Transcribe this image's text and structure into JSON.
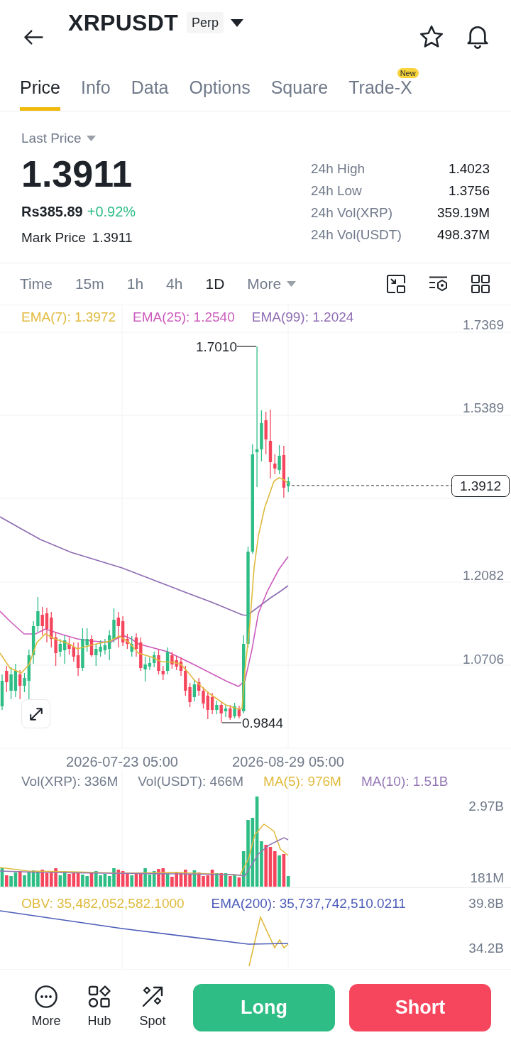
{
  "header": {
    "symbol": "XRPUSDT",
    "contract_badge": "Perp"
  },
  "tabs": [
    {
      "label": "Price",
      "selected": true
    },
    {
      "label": "Info",
      "selected": false
    },
    {
      "label": "Data",
      "selected": false
    },
    {
      "label": "Options",
      "selected": false
    },
    {
      "label": "Square",
      "selected": false
    },
    {
      "label": "Trade-X",
      "selected": false,
      "badge": "New"
    }
  ],
  "price_summary": {
    "price_type": "Last Price",
    "last_price": "1.3911",
    "local_price": "Rs385.89",
    "change": "+0.92%",
    "mark_price_label": "Mark Price",
    "mark_price": "1.3911"
  },
  "stats": [
    {
      "label": "24h High",
      "value": "1.4023"
    },
    {
      "label": "24h Low",
      "value": "1.3756"
    },
    {
      "label": "24h Vol(XRP)",
      "value": "359.19M"
    },
    {
      "label": "24h Vol(USDT)",
      "value": "498.37M"
    }
  ],
  "intervals": [
    {
      "label": "Time",
      "kind": "option",
      "selected": false
    },
    {
      "label": "15m",
      "kind": "option",
      "selected": false
    },
    {
      "label": "1h",
      "kind": "option",
      "selected": false
    },
    {
      "label": "4h",
      "kind": "option",
      "selected": false
    },
    {
      "label": "1D",
      "kind": "option",
      "selected": true
    },
    {
      "label": "More",
      "kind": "menu",
      "selected": false
    }
  ],
  "main_chart": {
    "indicators": [
      {
        "label": "EMA(7): 1.3972",
        "color": "#e0ba3c"
      },
      {
        "label": "EMA(25): 1.2540",
        "color": "#cc5cbd"
      },
      {
        "label": "EMA(99): 1.2024",
        "color": "#8d6bb3"
      }
    ],
    "y_axis": [
      "1.7369",
      "1.5389",
      "1.2082",
      "1.0706"
    ],
    "high_label": "1.7010",
    "low_label": "0.9844",
    "last_price_tag": "1.3912",
    "x_axis": [
      "2026-07-23 05:00",
      "2026-08-29 05:00"
    ]
  },
  "volume_chart": {
    "indicators": [
      {
        "label": "Vol(XRP): 336M",
        "color": "#707a8a"
      },
      {
        "label": "Vol(USDT): 466M",
        "color": "#707a8a"
      },
      {
        "label": "MA(5): 976M",
        "color": "#e0ba3c"
      },
      {
        "label": "MA(10): 1.51B",
        "color": "#9478b5"
      }
    ],
    "y_axis": [
      "2.97B",
      "181M"
    ]
  },
  "obv_chart": {
    "indicators": [
      {
        "label": "OBV: 35,482,052,582.1000",
        "color": "#e0ba3c"
      },
      {
        "label": "EMA(200): 35,737,742,510.0211",
        "color": "#4d5db8"
      }
    ],
    "y_axis": [
      "39.8B",
      "34.2B"
    ]
  },
  "bottom_bar": {
    "shortcuts": [
      {
        "label": "More",
        "kind": "more"
      },
      {
        "label": "Hub",
        "kind": "hub"
      },
      {
        "label": "Spot",
        "kind": "spot"
      }
    ],
    "actions": [
      {
        "label": "Long",
        "kind": "buy"
      },
      {
        "label": "Short",
        "kind": "sell"
      }
    ]
  }
}
